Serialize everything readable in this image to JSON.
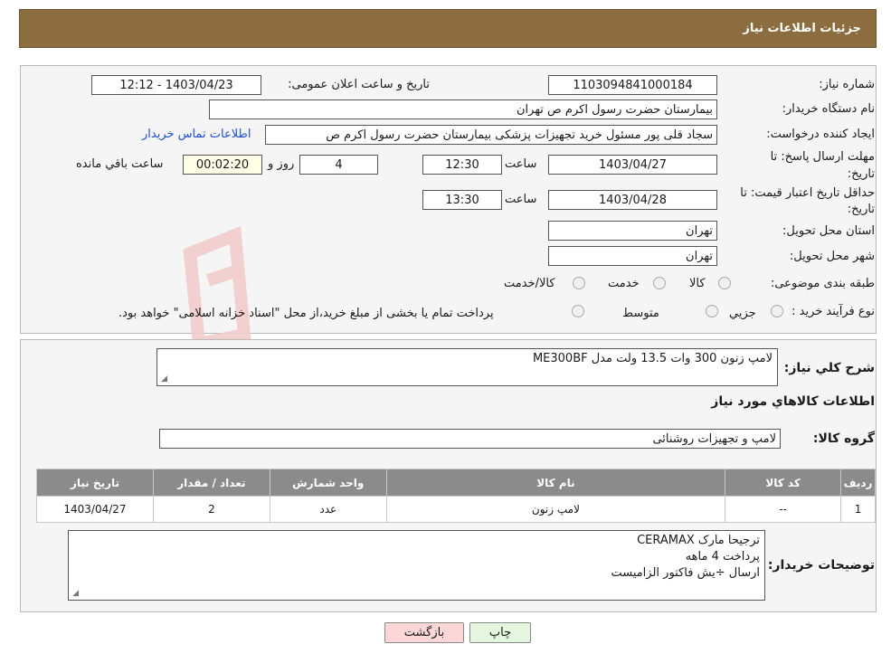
{
  "header": {
    "title": "جزئیات اطلاعات نیاز"
  },
  "need": {
    "number_label": "شماره نیاز:",
    "number_value": "1103094841000184",
    "announce_label": "تاریخ و ساعت اعلان عمومی:",
    "announce_value": "1403/04/23 - 12:12",
    "buyer_label": "نام دستگاه خریدار:",
    "buyer_value": "بیمارستان حضرت رسول اکرم ص  تهران",
    "creator_label": "ایجاد کننده درخواست:",
    "creator_value": "سجاد قلی پور مسئول خرید تجهیزات پزشکی  بیمارستان حضرت رسول اکرم ص",
    "contact_link": "اطلاعات تماس خریدار",
    "deadline_label_1": "مهلت ارسال پاسخ: تا",
    "deadline_label_2": "تاریخ:",
    "deadline_date": "1403/04/27",
    "time_label": "ساعت",
    "deadline_time": "12:30",
    "days_value": "4",
    "days_label": "روز و",
    "remaining_value": "00:02:20",
    "remaining_label": "ساعت باقي مانده",
    "validity_label_1": "حداقل تاریخ اعتبار قیمت: تا",
    "validity_label_2": "تاریخ:",
    "validity_date": "1403/04/28",
    "validity_time": "13:30",
    "province_label": "استان محل تحویل:",
    "province_value": "تهران",
    "city_label": "شهر محل تحویل:",
    "city_value": "تهران",
    "category_label": "طبقه بندی موضوعی:",
    "category_options": [
      "کالا",
      "خدمت",
      "کالا/خدمت"
    ],
    "process_label": "نوع فرآیند خرید :",
    "process_options": [
      "جزيي",
      "متوسط"
    ],
    "process_note": "پرداخت تمام یا بخشی از مبلغ خرید،از محل \"اسناد خزانه اسلامی\" خواهد بود."
  },
  "details": {
    "summary_label": "شرح کلي نياز:",
    "summary_value": "لامپ زنون 300 وات 13.5 ولت مدل ME300BF",
    "goods_title": "اطلاعات کالاهاي مورد نياز",
    "group_label": "گروه کالا:",
    "group_value": "لامپ و تجهیزات روشنائی",
    "table": {
      "headers": [
        "رديف",
        "کد کالا",
        "نام کالا",
        "واحد شمارش",
        "تعداد / مقدار",
        "تاریخ نیاز"
      ],
      "rows": [
        [
          "1",
          "--",
          "لامپ زنون",
          "عدد",
          "2",
          "1403/04/27"
        ]
      ]
    },
    "buyer_notes_label": "توضیحات خریدار:",
    "buyer_notes_lines": [
      "ترجیحا مارک CERAMAX",
      "پرداخت 4 ماهه",
      "ارسال ÷یش فاکتور الزامیست"
    ]
  },
  "buttons": {
    "print": "چاپ",
    "back": "بازگشت"
  },
  "colors": {
    "header": "#8b6d3f",
    "link": "#1f4fd6",
    "back_button": "#fbd7d7",
    "print_button": "#e4f6de"
  }
}
